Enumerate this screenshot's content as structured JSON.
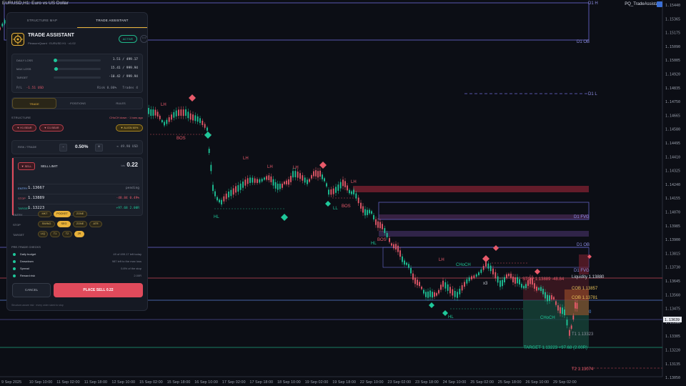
{
  "window": {
    "symbol_title": "EURUSD,H1: Euro vs US Dollar",
    "indicator_name": "PQ_TradeAssistant"
  },
  "panel": {
    "tabs": [
      {
        "label": "STRUCTURE MAP",
        "active": false
      },
      {
        "label": "TRADE ASSISTANT",
        "active": true
      }
    ],
    "title": "TRADE ASSISTANT",
    "subtitle": "PleasureQuant · EURUSD H1 · v1.02",
    "status": "ACTIVE",
    "more_icon": "ellipsis-icon",
    "risk": {
      "rows": [
        {
          "label": "DAILY LOSS",
          "value": "1.51 / 499.17",
          "fill": 0.003
        },
        {
          "label": "MAX LOSS",
          "value": "15.41 / 999.94",
          "fill": 0.015
        },
        {
          "label": "TARGET",
          "value": "-10.42 / 999.94",
          "fill": 0.0
        }
      ],
      "pnl_label": "P/L",
      "pnl_value": "-1.51 USD",
      "risk_text": "Risk 0.00%",
      "trades_text": "Trades 4"
    },
    "mode_tabs": [
      {
        "label": "TRADE",
        "active": true
      },
      {
        "label": "POSITIONS",
        "active": false
      },
      {
        "label": "RULES",
        "active": false
      }
    ],
    "structure": {
      "label": "STRUCTURE",
      "note": "CHoCH down · 1 bars ago",
      "chips": [
        "H1 BEAR",
        "D1 BEAR"
      ],
      "aligned": "ALIGN 60%"
    },
    "risk_trade": {
      "label": "RISK / TRADE",
      "minus": "-",
      "plus": "+",
      "value": "0.50%",
      "usd": "≈ 49.90 USD"
    },
    "order": {
      "side": "SELL",
      "type": "SELL LIMIT",
      "lot_label": "lots",
      "lot": "0.22",
      "rows": [
        {
          "key": "ENTRY",
          "value": "1.13667",
          "right": "pending",
          "key_color": "#7fb0ff",
          "right_color": "#8b909d"
        },
        {
          "key": "STOP",
          "value": "1.13889",
          "right": "-48.84  0.49%",
          "key_color": "#e85a6a",
          "right_color": "#e85a6a"
        },
        {
          "key": "TARGET",
          "value": "1.13223",
          "right": "+97.68  2.00R",
          "key_color": "#1fc79a",
          "right_color": "#1fc79a"
        }
      ]
    },
    "modes": {
      "entry": {
        "label": "ENTRY",
        "options": [
          "MKT",
          "POCKET",
          "ZONE"
        ],
        "selected": "POCKET"
      },
      "stop": {
        "label": "STOP",
        "options": [
          "SWING",
          "SEG",
          "ZONE",
          "ATR"
        ],
        "selected": "SEG"
      },
      "target": {
        "label": "TARGET",
        "options": [
          "LIQ",
          "T1",
          "T2",
          "2R"
        ],
        "selected": "2R"
      }
    },
    "pretrade": {
      "label": "PRE-TRADE CHECKS",
      "checks": [
        {
          "name": "Daily budget",
          "value": "49 of 499.17 left today"
        },
        {
          "name": "Drawdown",
          "value": "987 left to the max loss"
        },
        {
          "name": "Spread",
          "value": "0.8% of the stop"
        },
        {
          "name": "Reward:risk",
          "value": "2.00R"
        }
      ]
    },
    "cancel_label": "CANCEL",
    "place_label": "PLACE SELL 0.22",
    "footer": "Structure-aware risk · every order sized to stop"
  },
  "chart_data": {
    "type": "candlestick",
    "symbol": "EURUSD",
    "timeframe": "H1",
    "y_ticks": [
      "1.15440",
      "1.15365",
      "1.15175",
      "1.15090",
      "1.15005",
      "1.14920",
      "1.14835",
      "1.14750",
      "1.14665",
      "1.14580",
      "1.14495",
      "1.14410",
      "1.14325",
      "1.14240",
      "1.14155",
      "1.14070",
      "1.13985",
      "1.13900",
      "1.13815",
      "1.13730",
      "1.13645",
      "1.13560",
      "1.13475",
      "1.13390",
      "1.13305",
      "1.13220",
      "1.13135",
      "1.13050"
    ],
    "x_ticks": [
      "9 Sep 2025",
      "10 Sep 10:00",
      "11 Sep 02:00",
      "11 Sep 18:00",
      "12 Sep 10:00",
      "15 Sep 02:00",
      "15 Sep 18:00",
      "16 Sep 10:00",
      "17 Sep 02:00",
      "17 Sep 18:00",
      "18 Sep 10:00",
      "19 Sep 02:00",
      "19 Sep 18:00",
      "22 Sep 10:00",
      "23 Sep 02:00",
      "23 Sep 18:00",
      "24 Sep 10:00",
      "25 Sep 02:00",
      "25 Sep 18:00",
      "26 Sep 10:00",
      "29 Sep 02:00"
    ],
    "price_label": "1.13639",
    "levels": {
      "stop": "1.13889",
      "entry": "1.13667",
      "target": "1.13223",
      "bid": "1.13639"
    },
    "annotations": {
      "d1_h": "D1 H",
      "d1_ob": "D1 OB",
      "d1_l": "D1 L",
      "d1_fvg": "D1 FVG",
      "d1_ob2": "D1 OB",
      "d1_fvg2": "D1 FVG",
      "stop_text": "STOP 1.13889 -48.84",
      "liquidity": "Liquidity 1.13880",
      "cob": "COB 1.13857",
      "cob2": "COB 1.13781",
      "target_text": "TARGET 1.13223 +97.68 (2.00R)",
      "t1": "T1 1.13323",
      "t2": "T2 1.13074",
      "lh": "LH",
      "ll": "LL",
      "hl": "HL",
      "bos": "BOS",
      "choch": "CHoCH",
      "x3": "x3",
      "zero": "0"
    }
  }
}
